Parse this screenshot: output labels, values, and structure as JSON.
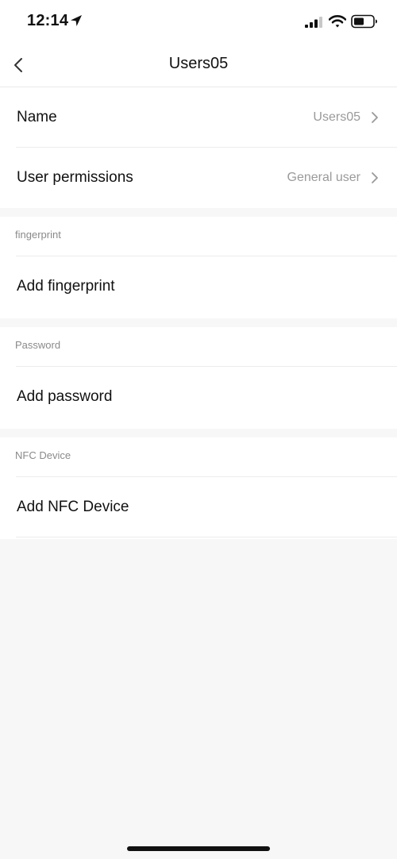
{
  "status_bar": {
    "time": "12:14"
  },
  "nav": {
    "title": "Users05"
  },
  "profile": {
    "name_label": "Name",
    "name_value": "Users05",
    "permissions_label": "User permissions",
    "permissions_value": "General user"
  },
  "sections": {
    "fingerprint": {
      "title": "fingerprint",
      "action": "Add fingerprint"
    },
    "password": {
      "title": "Password",
      "action": "Add password"
    },
    "nfc": {
      "title": "NFC Device",
      "action": "Add NFC Device"
    }
  },
  "colors": {
    "background": "#f7f7f7",
    "card": "#ffffff",
    "text_primary": "#111111",
    "text_secondary": "#9a9a9a",
    "divider": "#ececec"
  },
  "icons": {
    "back": "chevron-left-icon",
    "row_arrow": "chevron-right-icon",
    "location": "location-arrow-icon",
    "signal": "cellular-signal-icon",
    "wifi": "wifi-icon",
    "battery": "battery-icon"
  }
}
